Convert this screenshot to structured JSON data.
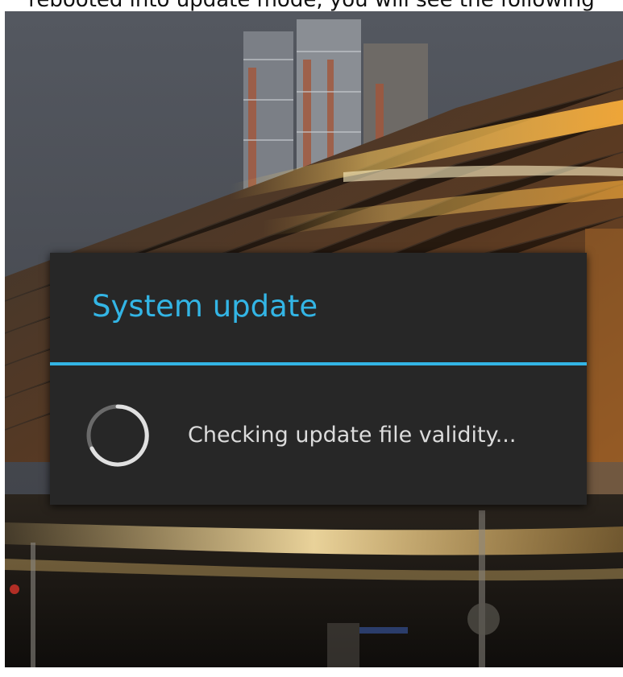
{
  "top_caption": "rebooted into update mode, you will see the following",
  "dialog": {
    "title": "System update",
    "message": "Checking update file validity..."
  },
  "colors": {
    "accent": "#33b5e5",
    "dialog_background": "#272727",
    "message_text": "#dcdcdc"
  },
  "icons": {
    "spinner": "progress-spinner-icon"
  }
}
